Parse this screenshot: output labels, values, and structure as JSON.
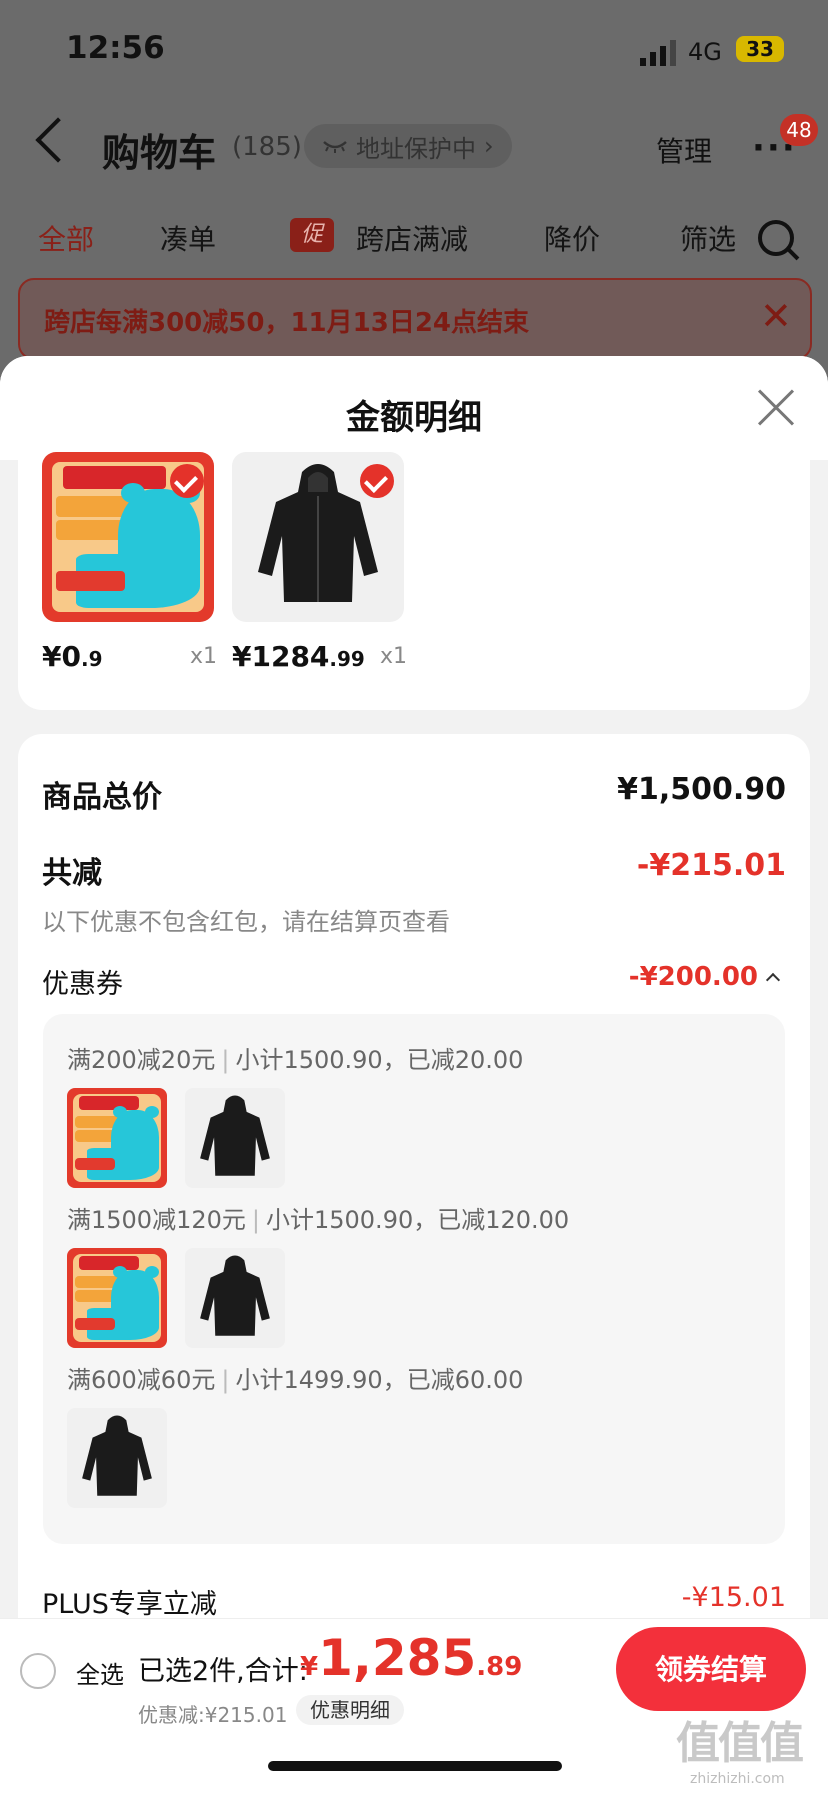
{
  "status_bar": {
    "time": "12:56",
    "network": "4G",
    "battery": "33"
  },
  "nav": {
    "title": "购物车",
    "count": "(185)",
    "address_protect": "地址保护中",
    "manage": "管理",
    "more": "···",
    "badge": "48"
  },
  "filter_tabs": {
    "all": "全部",
    "bundle": "凑单",
    "promo_chip": "促",
    "cross_store": "跨店满减",
    "price_drop": "降价",
    "filter": "筛选"
  },
  "promo_banner": {
    "text": "跨店每满300减50，11月13日24点结束"
  },
  "sheet": {
    "title": "金额明细",
    "items": [
      {
        "price_int": "¥0",
        "price_dec": ".9",
        "qty": "x1"
      },
      {
        "price_int": "¥1284",
        "price_dec": ".99",
        "qty": "x1"
      }
    ],
    "summary": {
      "goods_total_label": "商品总价",
      "goods_total_value": "¥1,500.90",
      "reduce_label": "共减",
      "reduce_value": "-¥215.01",
      "reduce_hint": "以下优惠不包含红包，请在结算页查看",
      "coupon_label": "优惠券",
      "coupon_value": "-¥200.00",
      "plus_label": "PLUS专享立减",
      "plus_value": "-¥15.01"
    },
    "coupons": [
      {
        "rule": "满200减20元",
        "detail": "小计1500.90，已减20.00"
      },
      {
        "rule": "满1500减120元",
        "detail": "小计1500.90，已减120.00"
      },
      {
        "rule": "满600减60元",
        "detail": "小计1499.90，已减60.00"
      }
    ]
  },
  "bottom_bar": {
    "select_all": "全选",
    "selected": "已选2件,合计:",
    "currency": "¥",
    "total_int": "1,285",
    "total_dec": ".89",
    "discount": "优惠减:¥215.01",
    "detail_button": "优惠明细",
    "checkout": "领券结算"
  },
  "watermark": {
    "main": "值值值",
    "sub": "zhizhizhi.com"
  }
}
